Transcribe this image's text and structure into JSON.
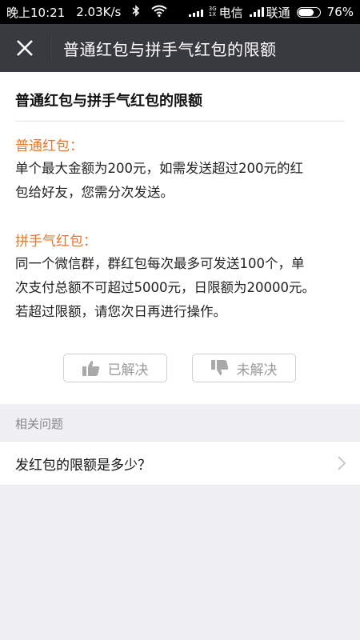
{
  "status_bar": {
    "time": "晚上10:21",
    "speed": "2.03K/s",
    "carrier1": "电信",
    "carrier2": "联通",
    "net_top": "3G",
    "net_bottom": "1X",
    "battery": "76%",
    "battery_level": 0.76
  },
  "title_bar": {
    "title": "普通红包与拼手气红包的限额"
  },
  "article": {
    "title": "普通红包与拼手气红包的限额",
    "sections": [
      {
        "heading": "普通红包：",
        "lines": [
          "单个最大金额为200元，如需发送超过200元的红",
          "包给好友，您需分次发送。"
        ]
      },
      {
        "heading": "拼手气红包：",
        "lines": [
          "同一个微信群，群红包每次最多可发送100个，单",
          "次支付总额不可超过5000元，日限额为20000元。",
          "若超过限额，请您次日再进行操作。"
        ]
      }
    ]
  },
  "feedback": {
    "resolved_label": "已解决",
    "unresolved_label": "未解决"
  },
  "related": {
    "header": "相关问题",
    "items": [
      {
        "label": "发红包的限额是多少？"
      }
    ]
  },
  "colors": {
    "accent": "#e8772b",
    "titlebar": "#393a3f"
  }
}
